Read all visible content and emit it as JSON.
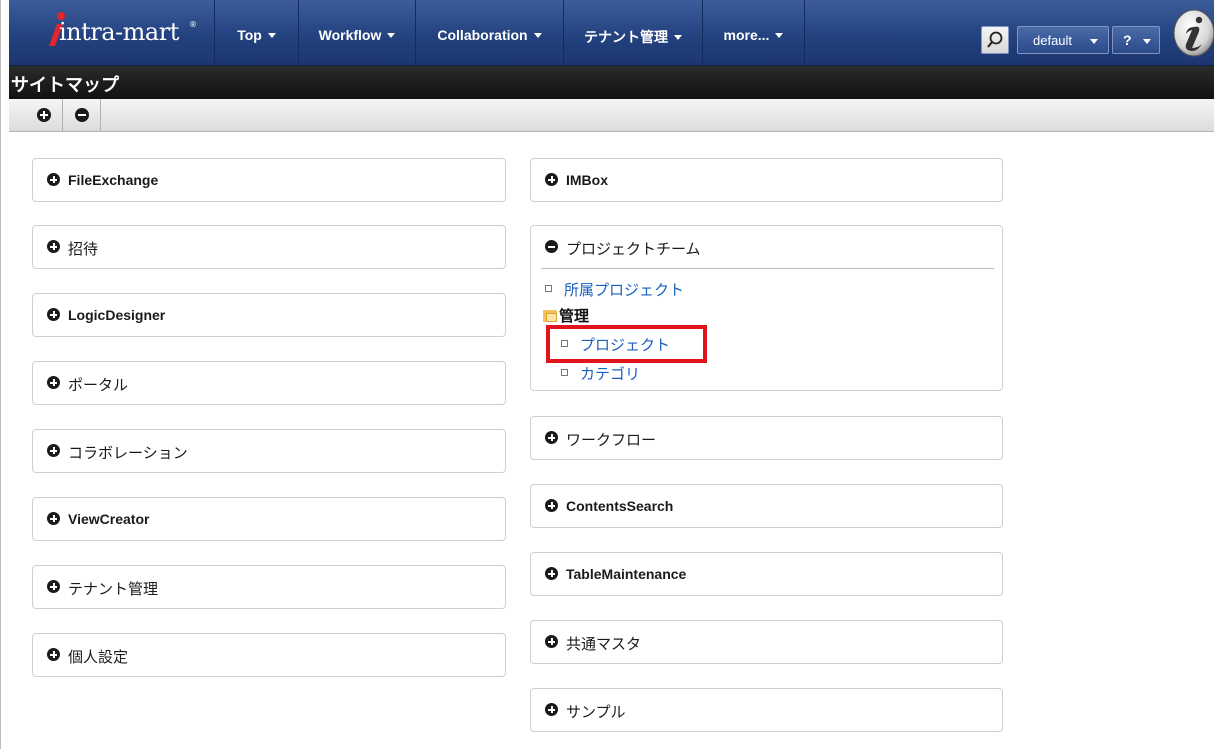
{
  "topnav": {
    "logo_text": "intra-mart",
    "logo_reg": "®",
    "menus": [
      {
        "label": "Top"
      },
      {
        "label": "Workflow"
      },
      {
        "label": "Collaboration"
      },
      {
        "label": "テナント管理"
      },
      {
        "label": "more..."
      }
    ],
    "search_icon": "search-icon",
    "locale_label": "default",
    "help_label": "?",
    "avatar_icon": "user-i-icon",
    "colors": {
      "nav": "#23427f",
      "link": "#1a5fbf",
      "highlight": "#e0141b"
    }
  },
  "page": {
    "title": "サイトマップ"
  },
  "toolbar": {
    "expand_icon": "plus-circle-icon",
    "collapse_icon": "minus-circle-icon"
  },
  "left_panels": [
    {
      "label": "FileExchange"
    },
    {
      "label": "招待"
    },
    {
      "label": "LogicDesigner"
    },
    {
      "label": "ポータル"
    },
    {
      "label": "コラボレーション"
    },
    {
      "label": "ViewCreator"
    },
    {
      "label": "テナント管理"
    },
    {
      "label": "個人設定"
    }
  ],
  "right_panels": [
    {
      "label": "IMBox"
    },
    {
      "label": "プロジェクトチーム"
    },
    {
      "label": "ワークフロー"
    },
    {
      "label": "ContentsSearch"
    },
    {
      "label": "TableMaintenance"
    },
    {
      "label": "共通マスタ"
    },
    {
      "label": "サンプル"
    }
  ],
  "project_team": {
    "item_my_project": "所属プロジェクト",
    "folder_admin": "管理",
    "item_project": "プロジェクト",
    "item_category": "カテゴリ"
  }
}
